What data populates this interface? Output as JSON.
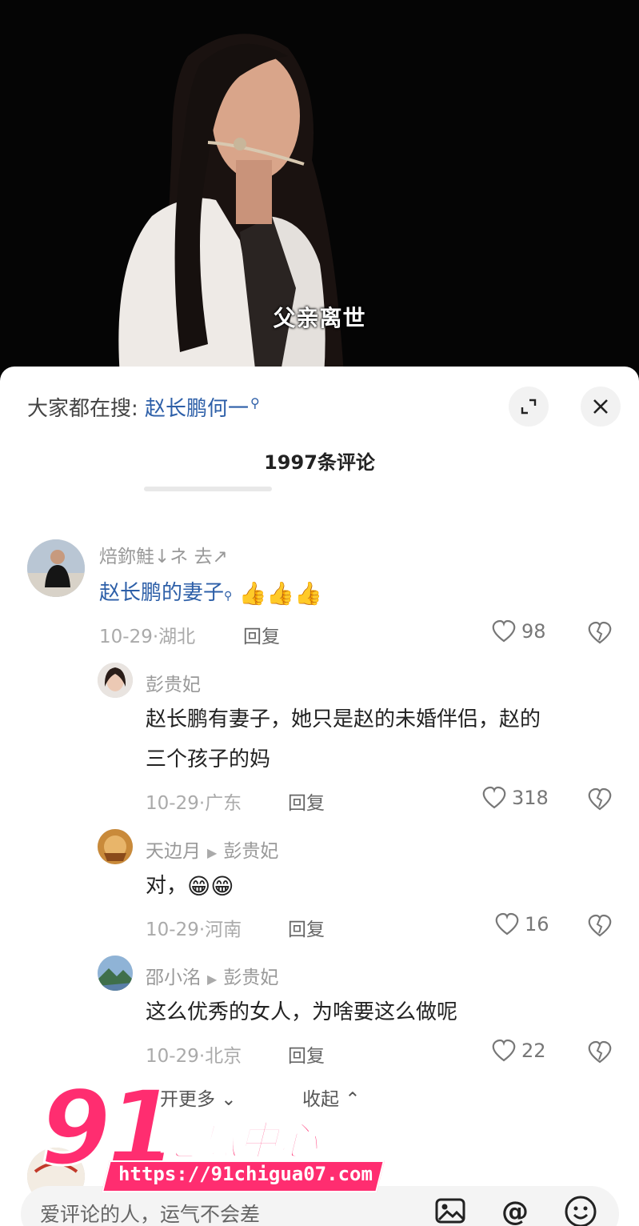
{
  "video": {
    "subtitle": "父亲离世"
  },
  "header": {
    "search_prefix": "大家都在搜:",
    "search_keyword": "赵长鹏何一",
    "comment_count_title": "1997条评论"
  },
  "comments": [
    {
      "username": "焙鉨鮭↓ネ 去↗",
      "text": "赵长鹏的妻子",
      "emoji": "👍👍👍",
      "meta": "10-29·湖北",
      "reply": "回复",
      "likes": "98"
    }
  ],
  "replies": [
    {
      "username": "彭贵妃",
      "reply_to": "",
      "text_line1": "赵长鹏有妻子，她只是赵的未婚伴侣，赵的",
      "text_line2": "三个孩子的妈",
      "meta": "10-29·广东",
      "reply": "回复",
      "likes": "318"
    },
    {
      "username": "天边月",
      "reply_to": "彭贵妃",
      "text_line1": "对，",
      "emoji": "😁😁",
      "meta": "10-29·河南",
      "reply": "回复",
      "likes": "16"
    },
    {
      "username": "邵小洺",
      "reply_to": "彭贵妃",
      "text_line1": "这么优秀的女人，为啥要这么做呢",
      "meta": "10-29·北京",
      "reply": "回复",
      "likes": "22"
    }
  ],
  "thread_controls": {
    "expand_more": "开更多",
    "collapse": "收起"
  },
  "input": {
    "placeholder": "爱评论的人，运气不会差"
  },
  "watermark": {
    "number": "91",
    "brand": "吃瓜中心",
    "url": "https://91chigua07.com"
  },
  "colors": {
    "keyword_blue": "#2d5fa8",
    "watermark_pink": "#ff2d70"
  }
}
